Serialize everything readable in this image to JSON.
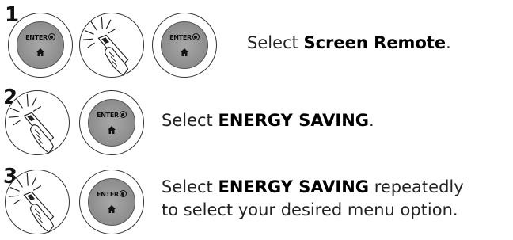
{
  "steps": [
    {
      "number": "1",
      "button_label": "ENTER",
      "text_before": "Select ",
      "text_bold": "Screen Remote",
      "text_after": "."
    },
    {
      "number": "2",
      "button_label": "ENTER",
      "text_before": "Select ",
      "text_bold": "ENERGY SAVING",
      "text_after": "."
    },
    {
      "number": "3",
      "button_label": "ENTER",
      "text_before": "Select ",
      "text_bold": "ENERGY SAVING",
      "text_after": " repeatedly",
      "text_line2": "to select your desired menu option."
    }
  ],
  "icons": {
    "enter_button": "enter-button-icon",
    "home": "home-icon",
    "remote_hand": "remote-pointing-hand-icon"
  }
}
